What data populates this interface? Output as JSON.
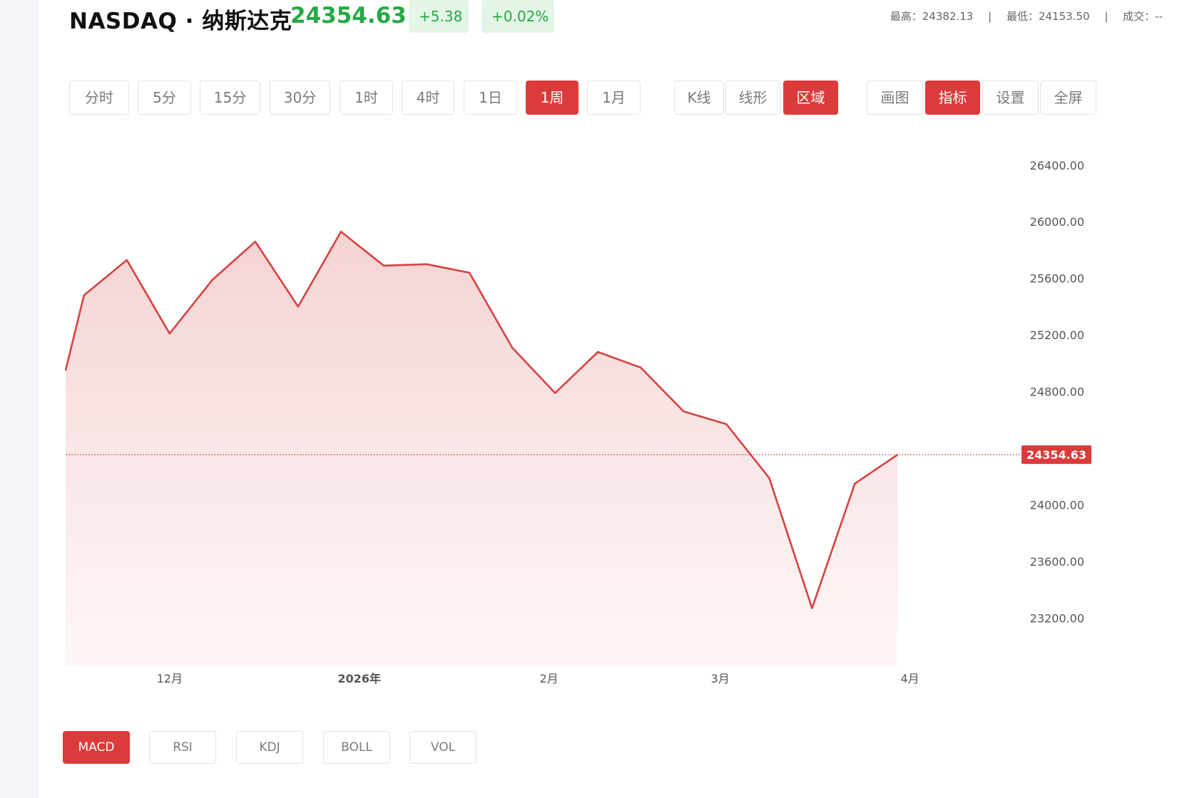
{
  "header": {
    "title": "NASDAQ · 纳斯达克",
    "price": "24354.63",
    "change_abs": "+5.38",
    "change_pct": "+0.02%",
    "stats": {
      "high": "最高：24382.13",
      "low": "最低：24153.50",
      "volume": "成交：--",
      "separator": "|"
    }
  },
  "toolbar": {
    "periods": [
      {
        "label": "分时",
        "active": false
      },
      {
        "label": "5分",
        "active": false
      },
      {
        "label": "15分",
        "active": false
      },
      {
        "label": "30分",
        "active": false
      },
      {
        "label": "1时",
        "active": false
      },
      {
        "label": "4时",
        "active": false
      },
      {
        "label": "1日",
        "active": false
      },
      {
        "label": "1周",
        "active": true
      },
      {
        "label": "1月",
        "active": false
      }
    ],
    "chart_types": [
      {
        "label": "K线",
        "active": false
      },
      {
        "label": "线形",
        "active": false
      },
      {
        "label": "区域",
        "active": true
      }
    ],
    "tools": [
      {
        "label": "画图",
        "active": false
      },
      {
        "label": "指标",
        "active": true
      },
      {
        "label": "设置",
        "active": false
      },
      {
        "label": "全屏",
        "active": false
      }
    ]
  },
  "indicators": [
    {
      "label": "MACD",
      "active": true
    },
    {
      "label": "RSI",
      "active": false
    },
    {
      "label": "KDJ",
      "active": false
    },
    {
      "label": "BOLL",
      "active": false
    },
    {
      "label": "VOL",
      "active": false
    }
  ],
  "colors": {
    "accent": "#dc3b3b",
    "up_green": "#27a844",
    "up_green_bg": "#e3f5e6",
    "line": "#d64141",
    "fill_top": "#f1c4c4",
    "fill_bottom": "#fdf0f0",
    "axis_text": "#555555",
    "last_price_line": "#c04040"
  },
  "chart_data": {
    "type": "area",
    "title": "",
    "xlabel": "",
    "ylabel": "",
    "ylim": [
      22860,
      26560
    ],
    "yticks": [
      23200,
      23600,
      24000,
      24800,
      25200,
      25600,
      26000,
      26400
    ],
    "ytick_labels": [
      "23200.00",
      "23600.00",
      "24000.00",
      "24800.00",
      "25200.00",
      "25600.00",
      "26000.00",
      "26400.00"
    ],
    "x_start": "2025-11-14",
    "x_end": "2026-04-19",
    "x_tick_labels": [
      {
        "date": "2025-12-01",
        "label": "12月",
        "bold": false
      },
      {
        "date": "2026-01-01",
        "label": "2026年",
        "bold": true
      },
      {
        "date": "2026-02-01",
        "label": "2月",
        "bold": false
      },
      {
        "date": "2026-03-01",
        "label": "3月",
        "bold": false
      },
      {
        "date": "2026-04-01",
        "label": "4月",
        "bold": false
      }
    ],
    "last_price": 24354.63,
    "last_price_label": "24354.63",
    "series": [
      {
        "x": [
          "2025-11-14",
          "2025-11-17",
          "2025-11-24",
          "2025-12-01",
          "2025-12-08",
          "2025-12-15",
          "2025-12-22",
          "2025-12-29",
          "2026-01-05",
          "2026-01-12",
          "2026-01-19",
          "2026-01-26",
          "2026-02-02",
          "2026-02-09",
          "2026-02-16",
          "2026-02-23",
          "2026-03-02",
          "2026-03-09",
          "2026-03-16",
          "2026-03-23",
          "2026-03-30",
          "2026-04-06"
        ],
        "values": [
          24950,
          25480,
          25730,
          25210,
          25590,
          25860,
          25400,
          25930,
          25690,
          25700,
          25640,
          25110,
          24790,
          25080,
          24970,
          24660,
          24570,
          24190,
          23270,
          24150,
          24354.63,
          24354.63
        ]
      }
    ]
  }
}
